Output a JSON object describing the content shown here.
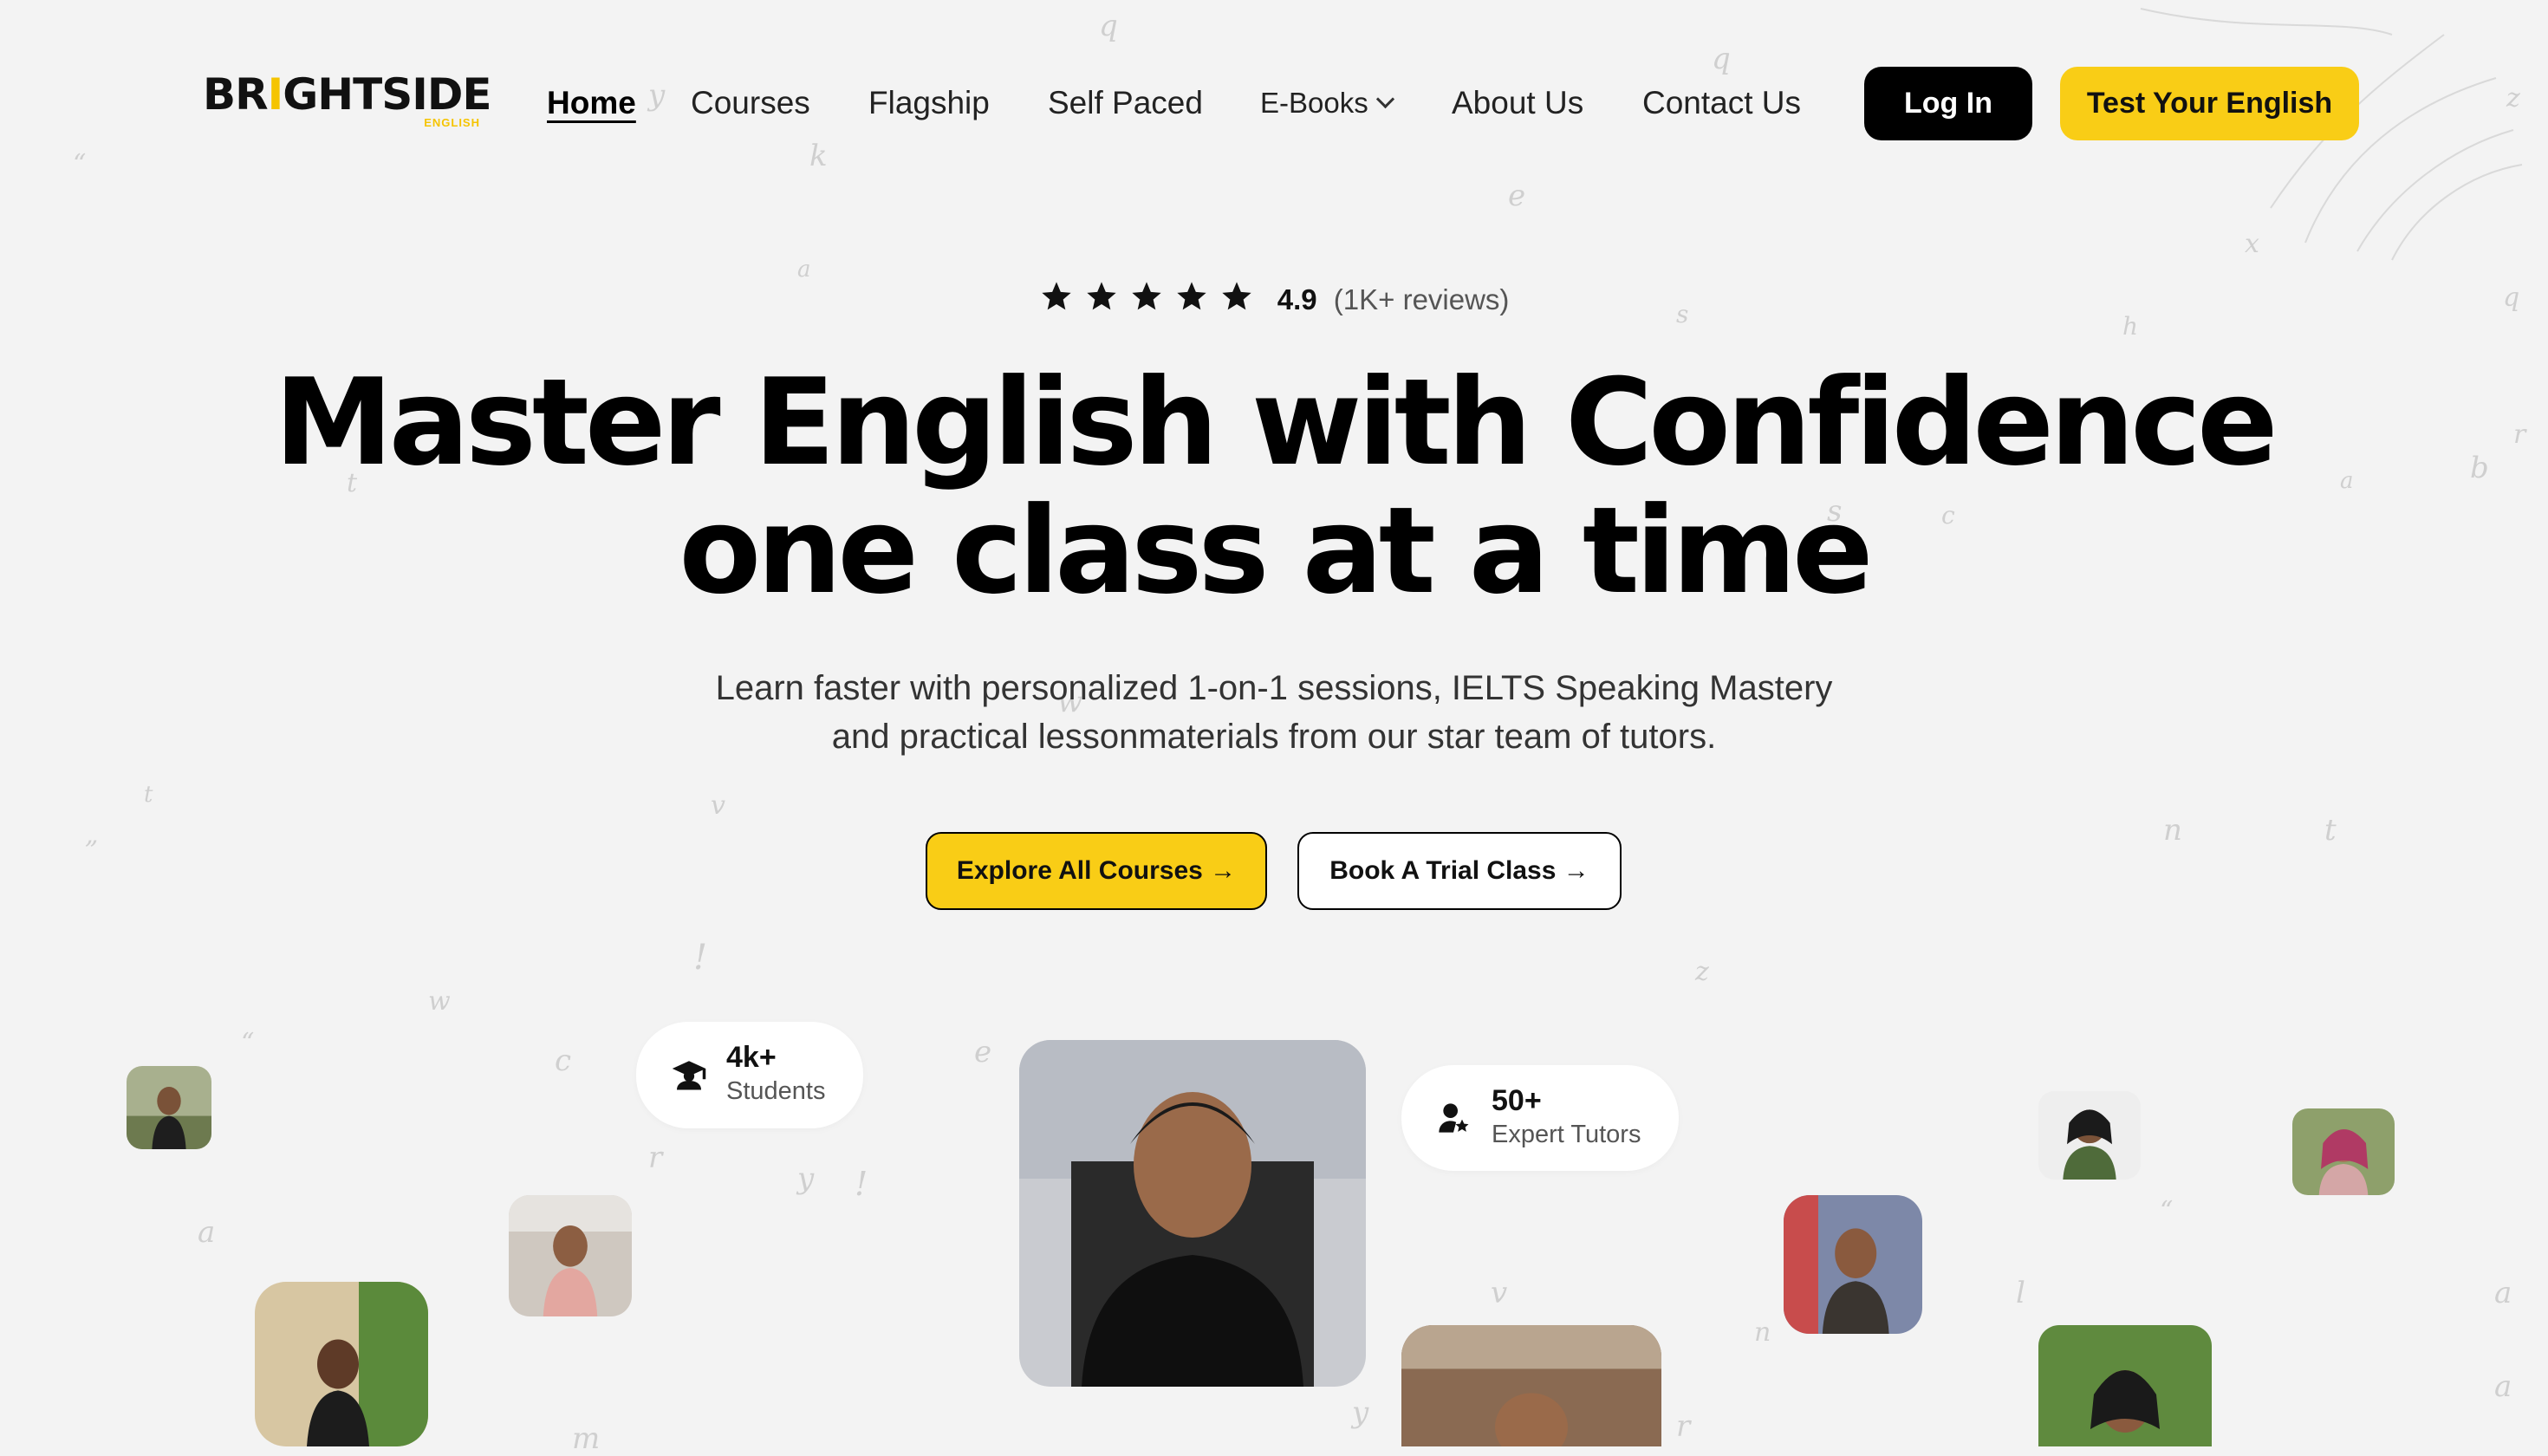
{
  "brand": {
    "name": "BRIGHTSIDE",
    "sub": "ENGLISH",
    "accent": "#f9cd16"
  },
  "nav": {
    "items": [
      {
        "label": "Home",
        "active": true
      },
      {
        "label": "Courses"
      },
      {
        "label": "Flagship"
      },
      {
        "label": "Self Paced"
      },
      {
        "label": "E-Books",
        "dropdown": true
      },
      {
        "label": "About Us"
      },
      {
        "label": "Contact Us"
      }
    ],
    "login_label": "Log In",
    "test_label": "Test Your English"
  },
  "rating": {
    "stars": 5,
    "value": "4.9",
    "count": "(1K+ reviews)",
    "icon": "star-icon"
  },
  "hero": {
    "headline_line1": "Master English with Confidence",
    "headline_line2": "one class at a time",
    "sub_line1": "Learn faster with personalized 1-on-1 sessions, IELTS Speaking Mastery",
    "sub_line2": "and practical lessonmaterials from our star team of tutors.",
    "explore_label": "Explore All Courses →",
    "trial_label": "Book A Trial Class →"
  },
  "stats": {
    "students": {
      "value": "4k+",
      "label": "Students",
      "icon": "graduate-icon"
    },
    "tutors": {
      "value": "50+",
      "label": "Expert Tutors",
      "icon": "user-star-icon"
    }
  },
  "colors": {
    "background": "#f3f3f3",
    "button_dark": "#000000",
    "button_accent": "#f9cd16"
  }
}
